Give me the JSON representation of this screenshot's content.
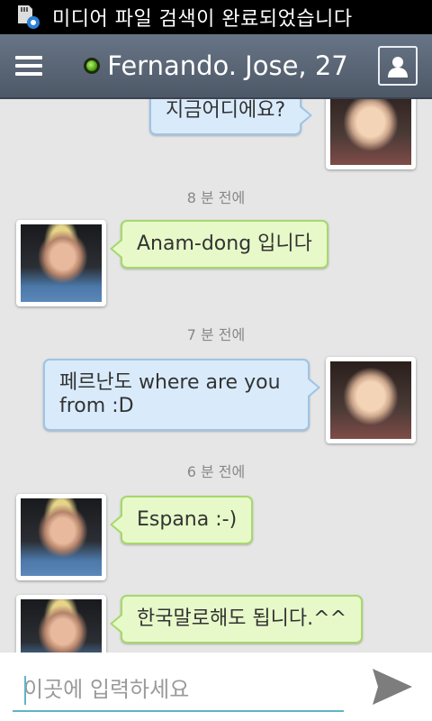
{
  "status_bar": {
    "notification": "미디어 파일 검색이 완료되었습니다",
    "icon": "sd-card-settings-icon"
  },
  "header": {
    "menu_icon": "hamburger-menu-icon",
    "presence": "online",
    "title": "Fernando. Jose, 27",
    "profile_icon": "contact-profile-icon"
  },
  "messages": [
    {
      "side": "outgoing",
      "text": "지금어디에요?"
    },
    {
      "side": "incoming",
      "text": "Anam-dong 입니다"
    },
    {
      "side": "outgoing",
      "text": "페르난도 where are you from :D"
    },
    {
      "side": "incoming",
      "text": "Espana :-)"
    },
    {
      "side": "incoming",
      "text": "한국말로해도 됩니다.^^"
    }
  ],
  "timestamps": [
    "8 분 전에",
    "7 분 전에",
    "6 분 전에"
  ],
  "composer": {
    "placeholder": "이곳에 입력하세요",
    "send_icon": "send-icon"
  },
  "colors": {
    "action_bar": "#5a6576",
    "incoming_bubble": "#e7f9c9",
    "incoming_border": "#a6d86c",
    "outgoing_bubble": "#d9ebfb",
    "outgoing_border": "#9ec4e6",
    "presence_online": "#4ea40c",
    "input_accent": "#5fb6c6"
  }
}
